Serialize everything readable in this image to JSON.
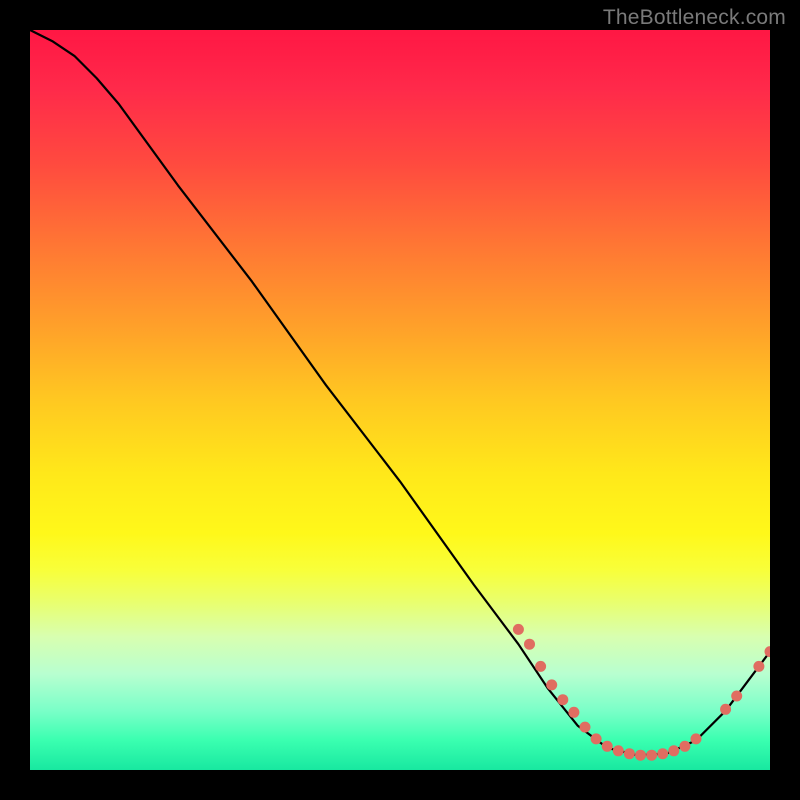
{
  "watermark": "TheBottleneck.com",
  "chart_data": {
    "type": "line",
    "title": "",
    "xlabel": "",
    "ylabel": "",
    "xlim": [
      0,
      100
    ],
    "ylim": [
      0,
      100
    ],
    "grid": false,
    "curve": [
      {
        "x": 0,
        "y": 100
      },
      {
        "x": 3,
        "y": 98.5
      },
      {
        "x": 6,
        "y": 96.5
      },
      {
        "x": 9,
        "y": 93.5
      },
      {
        "x": 12,
        "y": 90
      },
      {
        "x": 20,
        "y": 79
      },
      {
        "x": 30,
        "y": 66
      },
      {
        "x": 40,
        "y": 52
      },
      {
        "x": 50,
        "y": 39
      },
      {
        "x": 60,
        "y": 25
      },
      {
        "x": 66,
        "y": 17
      },
      {
        "x": 70,
        "y": 11
      },
      {
        "x": 74,
        "y": 6
      },
      {
        "x": 78,
        "y": 3
      },
      {
        "x": 82,
        "y": 2
      },
      {
        "x": 86,
        "y": 2.2
      },
      {
        "x": 90,
        "y": 4
      },
      {
        "x": 94,
        "y": 8
      },
      {
        "x": 97,
        "y": 12
      },
      {
        "x": 100,
        "y": 16
      }
    ],
    "dots": [
      {
        "x": 66,
        "y": 19
      },
      {
        "x": 67.5,
        "y": 17
      },
      {
        "x": 69,
        "y": 14
      },
      {
        "x": 70.5,
        "y": 11.5
      },
      {
        "x": 72,
        "y": 9.5
      },
      {
        "x": 73.5,
        "y": 7.8
      },
      {
        "x": 75,
        "y": 5.8
      },
      {
        "x": 76.5,
        "y": 4.2
      },
      {
        "x": 78,
        "y": 3.2
      },
      {
        "x": 79.5,
        "y": 2.6
      },
      {
        "x": 81,
        "y": 2.2
      },
      {
        "x": 82.5,
        "y": 2.0
      },
      {
        "x": 84,
        "y": 2.0
      },
      {
        "x": 85.5,
        "y": 2.2
      },
      {
        "x": 87,
        "y": 2.6
      },
      {
        "x": 88.5,
        "y": 3.2
      },
      {
        "x": 90,
        "y": 4.2
      },
      {
        "x": 94,
        "y": 8.2
      },
      {
        "x": 95.5,
        "y": 10
      },
      {
        "x": 98.5,
        "y": 14
      },
      {
        "x": 100,
        "y": 16
      }
    ]
  }
}
